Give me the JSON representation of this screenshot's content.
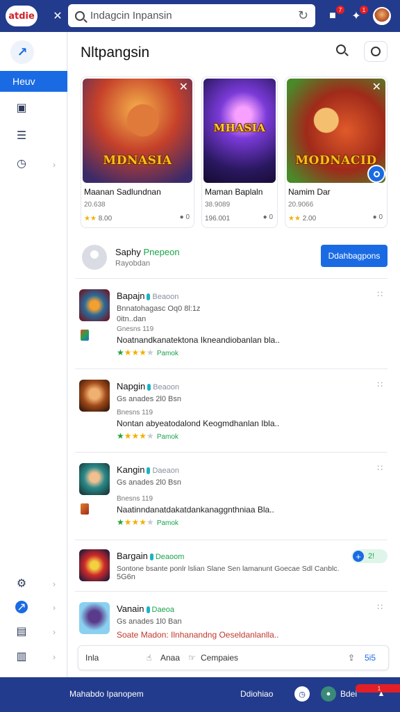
{
  "app": {
    "logo": "atdie",
    "search_placeholder": "Indagcin Inpansin",
    "notif_count": "7",
    "msg_count": "1"
  },
  "sidebar": {
    "active_label": "Heuv"
  },
  "page": {
    "title": "Nltpangsin"
  },
  "featured": [
    {
      "art_title": "MDNASIA",
      "name": "Maanan Sadlundnan",
      "sub": "20.638",
      "rating": "8.00",
      "more": "0"
    },
    {
      "art_title": "MHASIA",
      "name": "Maman Baplaln",
      "sub": "38.9089",
      "rating": "196.001",
      "more": "0"
    },
    {
      "art_title": "MODNACID",
      "name": "Namim Dar",
      "sub": "20.9066",
      "rating": "2.00",
      "more": "0"
    }
  ],
  "profile": {
    "name": "Saphy",
    "status": "Pnepeon",
    "sub": "Rayobdan",
    "button": "Ddahbagpons"
  },
  "items": [
    {
      "title": "Bapajn",
      "tag": "Beaoon",
      "meta1": "Bnnatohagasc Oq0 8l:1z",
      "meta2": "0itn..dan",
      "meta3": "Gnesns 119",
      "desc": "Noatnandkanatektona Ikneandiobanlan bla..",
      "label": "Pamok"
    },
    {
      "title": "Napgin",
      "tag": "Beaoon",
      "meta1": "Gs anades 2l0 Bsn",
      "meta2": "",
      "meta3": "Bnesns 119",
      "desc": "Nontan abyeatodalond Keogmdhanlan Ibla..",
      "label": "Pamok"
    },
    {
      "title": "Kangin",
      "tag": "Daeaon",
      "meta1": "Gs anades 2l0 Bsn",
      "meta2": "",
      "meta3": "Bnesns 119",
      "desc": "Naatinndanatdakatdankanaggnthniaa Bla..",
      "label": "Pamok"
    },
    {
      "title": "Bargain",
      "tag": "Deaoom",
      "meta1": "Sontone bsante ponlr lslian Slane Sen lamanunt Goecae Sdl Canblc.",
      "meta2": "5G6n",
      "pill": "2!",
      "desc": ""
    },
    {
      "title": "Vanain",
      "tag": "Daeoa",
      "meta1": "Gs anades 1l0 Ban",
      "desc": "Soate Madon: Ilnhanandng Oeseldanlanlla..",
      "label": ""
    }
  ],
  "actionbar": {
    "left": "Inla",
    "like": "Anaa",
    "compare": "Cempaies",
    "count": "5i5"
  },
  "footer": {
    "left": "Mahabdo Ipanopem",
    "middle": "Ddiohiao",
    "right": "Bdei",
    "badge": "1"
  }
}
